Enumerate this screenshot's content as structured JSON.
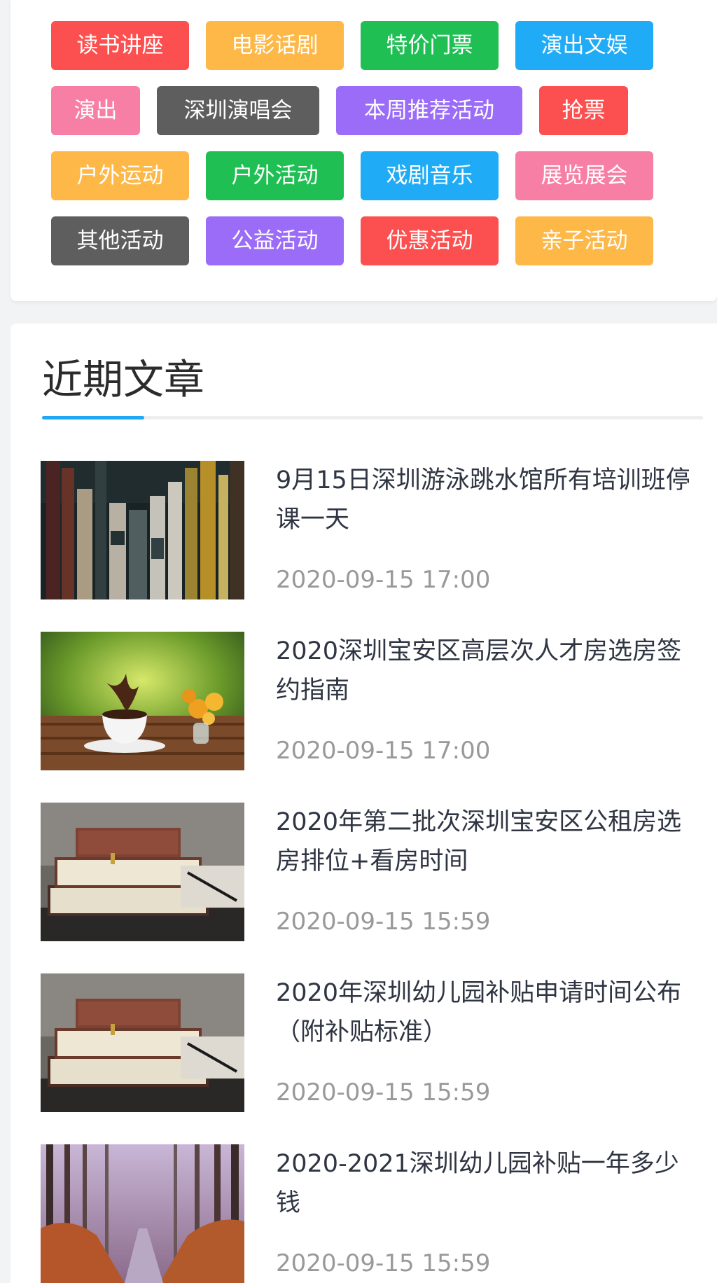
{
  "tags": {
    "rows": [
      [
        {
          "label": "读书讲座",
          "color": "#fc5050"
        },
        {
          "label": "电影话剧",
          "color": "#fdb848"
        },
        {
          "label": "特价门票",
          "color": "#1fbf54"
        },
        {
          "label": "演出文娱",
          "color": "#1fabf5"
        }
      ],
      [
        {
          "label": "演出",
          "color": "#f77fa5"
        },
        {
          "label": "深圳演唱会",
          "color": "#5e5e5e"
        },
        {
          "label": "本周推荐活动",
          "color": "#9b6cf7"
        },
        {
          "label": "抢票",
          "color": "#fc5050"
        }
      ],
      [
        {
          "label": "户外运动",
          "color": "#fdb848"
        },
        {
          "label": "户外活动",
          "color": "#1fbf54"
        },
        {
          "label": "戏剧音乐",
          "color": "#1fabf5"
        },
        {
          "label": "展览展会",
          "color": "#f77fa5"
        }
      ],
      [
        {
          "label": "其他活动",
          "color": "#5e5e5e"
        },
        {
          "label": "公益活动",
          "color": "#9b6cf7"
        },
        {
          "label": "优惠活动",
          "color": "#fc5050"
        },
        {
          "label": "亲子活动",
          "color": "#fdb848"
        }
      ]
    ]
  },
  "recent": {
    "title": "近期文章",
    "accent_color": "#1fa8f5",
    "articles": [
      {
        "title": "9月15日深圳游泳跳水馆所有培训班停课一天",
        "date": "2020-09-15 17:00",
        "thumb": "bookshelf-image"
      },
      {
        "title": "2020深圳宝安区高层次人才房选房签约指南",
        "date": "2020-09-15 17:00",
        "thumb": "coffee-splash-image"
      },
      {
        "title": "2020年第二批次深圳宝安区公租房选房排位+看房时间",
        "date": "2020-09-15 15:59",
        "thumb": "book-stack-image"
      },
      {
        "title": "2020年深圳幼儿园补贴申请时间公布（附补贴标准）",
        "date": "2020-09-15 15:59",
        "thumb": "book-stack-image"
      },
      {
        "title": "2020-2021深圳幼儿园补贴一年多少钱",
        "date": "2020-09-15 15:59",
        "thumb": "forest-road-image"
      }
    ]
  }
}
